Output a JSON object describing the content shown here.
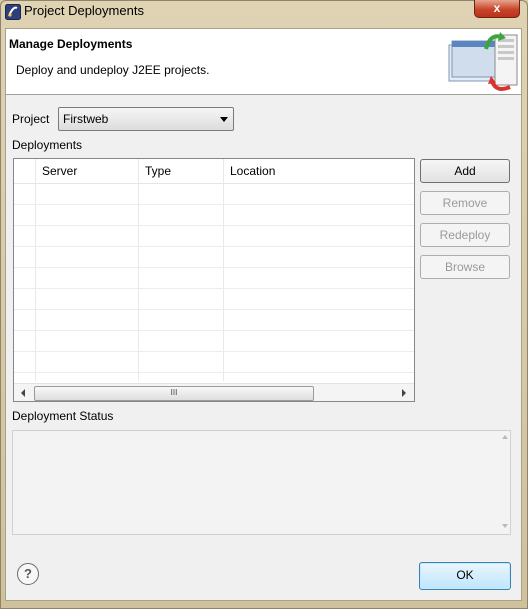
{
  "window": {
    "title": "Project Deployments",
    "close_label": "x"
  },
  "banner": {
    "title": "Manage Deployments",
    "description": "Deploy and undeploy J2EE projects."
  },
  "project": {
    "label": "Project",
    "selected": "Firstweb"
  },
  "deployments": {
    "label": "Deployments",
    "columns": [
      "Server",
      "Type",
      "Location"
    ],
    "rows": [],
    "scroll_grip": "III"
  },
  "buttons": {
    "add": "Add",
    "remove": "Remove",
    "redeploy": "Redeploy",
    "browse": "Browse"
  },
  "status": {
    "label": "Deployment Status",
    "text": ""
  },
  "footer": {
    "help": "?",
    "ok": "OK"
  },
  "colors": {
    "window_frame": "#d7c9a6",
    "close_button": "#c9452a",
    "ok_button_border": "#3c7fb1",
    "disabled_text": "#9a9a9a"
  }
}
